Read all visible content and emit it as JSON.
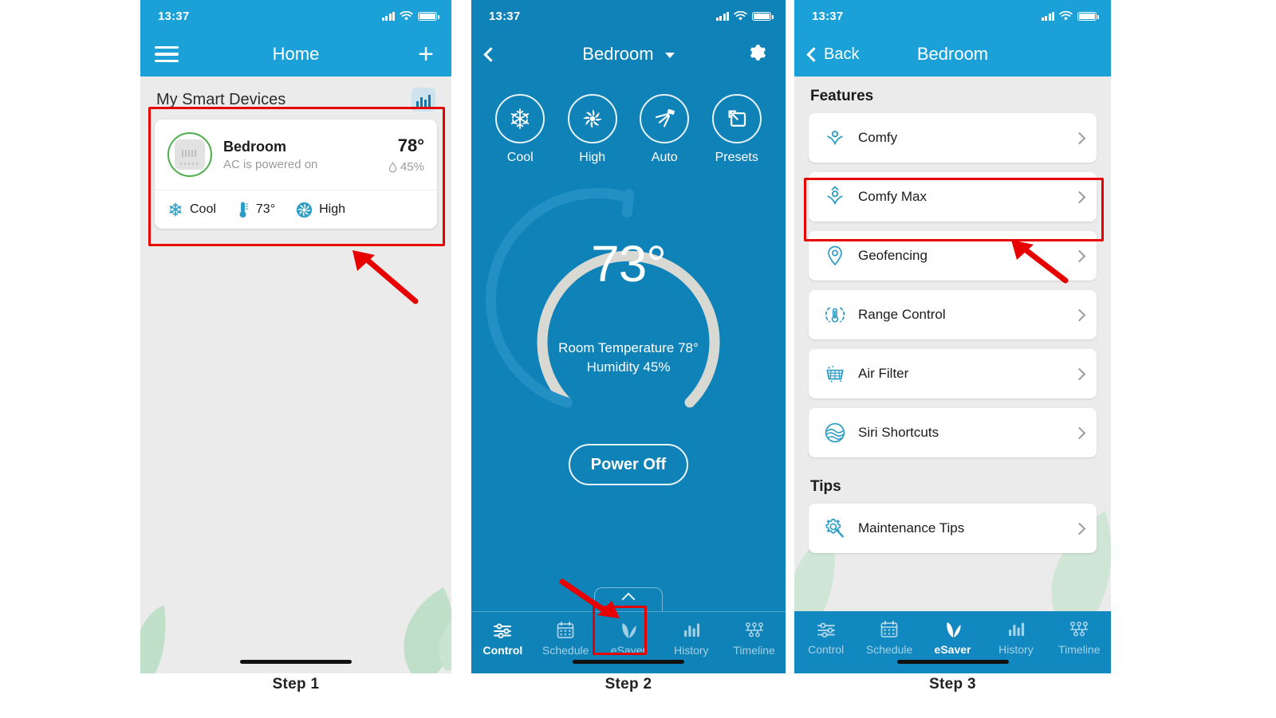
{
  "status_bar": {
    "time": "13:37",
    "signal_icon": "signal-bars-icon",
    "wifi_icon": "wifi-icon",
    "battery_icon": "battery-icon"
  },
  "steps": [
    {
      "caption": "Step 1"
    },
    {
      "caption": "Step 2"
    },
    {
      "caption": "Step 3"
    }
  ],
  "step1": {
    "nav": {
      "menu_icon": "hamburger-menu-icon",
      "title": "Home",
      "add_label": "+"
    },
    "section": {
      "title": "My Smart Devices",
      "chart_icon": "bar-chart-icon"
    },
    "device_card": {
      "name": "Bedroom",
      "status": "AC is powered on",
      "temperature": "78°",
      "humidity": "45%",
      "humidity_icon": "water-drop-icon",
      "device_icon": "thermostat-icon",
      "mode": {
        "icon": "snowflake-icon",
        "label": "Cool"
      },
      "set_temp": {
        "icon": "thermometer-icon",
        "label": "73°"
      },
      "fan": {
        "icon": "fan-icon",
        "label": "High"
      }
    }
  },
  "step2": {
    "nav": {
      "back_icon": "chevron-left-icon",
      "title": "Bedroom",
      "dropdown_icon": "caret-down-icon",
      "settings_icon": "gear-icon"
    },
    "modes": [
      {
        "icon": "snowflake-icon",
        "label": "Cool"
      },
      {
        "icon": "fan-icon",
        "label": "High"
      },
      {
        "icon": "swing-icon",
        "label": "Auto"
      },
      {
        "icon": "presets-icon",
        "label": "Presets"
      }
    ],
    "dial": {
      "target_temp": "73°",
      "room_temperature": "Room Temperature 78°",
      "humidity": "Humidity 45%",
      "arc_active_color": "#2390c4",
      "arc_track_color": "#d9d9d4"
    },
    "power_button": "Power Off",
    "pull_tab_icon": "chevron-up-icon",
    "tabs": [
      {
        "label": "Control",
        "icon": "sliders-icon",
        "active": true
      },
      {
        "label": "Schedule",
        "icon": "calendar-icon",
        "active": false
      },
      {
        "label": "eSaver",
        "icon": "leaf-icon",
        "active": false
      },
      {
        "label": "History",
        "icon": "bar-chart-icon",
        "active": false
      },
      {
        "label": "Timeline",
        "icon": "timeline-icon",
        "active": false
      }
    ]
  },
  "step3": {
    "nav": {
      "back_icon": "chevron-left-icon",
      "back_label": "Back",
      "title": "Bedroom"
    },
    "sections": [
      {
        "title": "Features",
        "items": [
          {
            "label": "Comfy",
            "icon": "comfy-person-icon",
            "chevron": "chevron-right-icon"
          },
          {
            "label": "Comfy Max",
            "icon": "comfy-max-person-icon",
            "chevron": "chevron-right-icon"
          },
          {
            "label": "Geofencing",
            "icon": "location-pin-icon",
            "chevron": "chevron-right-icon"
          },
          {
            "label": "Range Control",
            "icon": "range-thermometer-icon",
            "chevron": "chevron-right-icon"
          },
          {
            "label": "Air Filter",
            "icon": "air-filter-grid-icon",
            "chevron": "chevron-right-icon"
          },
          {
            "label": "Siri Shortcuts",
            "icon": "siri-waves-icon",
            "chevron": "chevron-right-icon"
          }
        ]
      },
      {
        "title": "Tips",
        "items": [
          {
            "label": "Maintenance Tips",
            "icon": "gear-wrench-icon",
            "chevron": "chevron-right-icon"
          }
        ]
      }
    ],
    "tabs": [
      {
        "label": "Control",
        "icon": "sliders-icon",
        "active": false
      },
      {
        "label": "Schedule",
        "icon": "calendar-icon",
        "active": false
      },
      {
        "label": "eSaver",
        "icon": "leaf-icon",
        "active": true
      },
      {
        "label": "History",
        "icon": "bar-chart-icon",
        "active": false
      },
      {
        "label": "Timeline",
        "icon": "timeline-icon",
        "active": false
      }
    ]
  },
  "annotations": {
    "highlight_color": "#e60000",
    "arrow_color": "#e60000",
    "highlights": [
      {
        "target": "step1-device-card"
      },
      {
        "target": "step2-esaver-tab"
      },
      {
        "target": "step3-comfy-max-row"
      }
    ],
    "arrows": [
      {
        "points_to": "step1-device-card"
      },
      {
        "points_to": "step2-esaver-tab"
      },
      {
        "points_to": "step3-comfy-max-row"
      }
    ]
  },
  "theme": {
    "header_blue": "#1ba0d8",
    "panel2_blue": "#0f82b8",
    "tabbar_blue": "#1288c0",
    "background_gray": "#ebebeb",
    "accent_green": "#4cae4c",
    "icon_teal": "#2b9cc4",
    "leaf_green": "#bfdfc8"
  }
}
